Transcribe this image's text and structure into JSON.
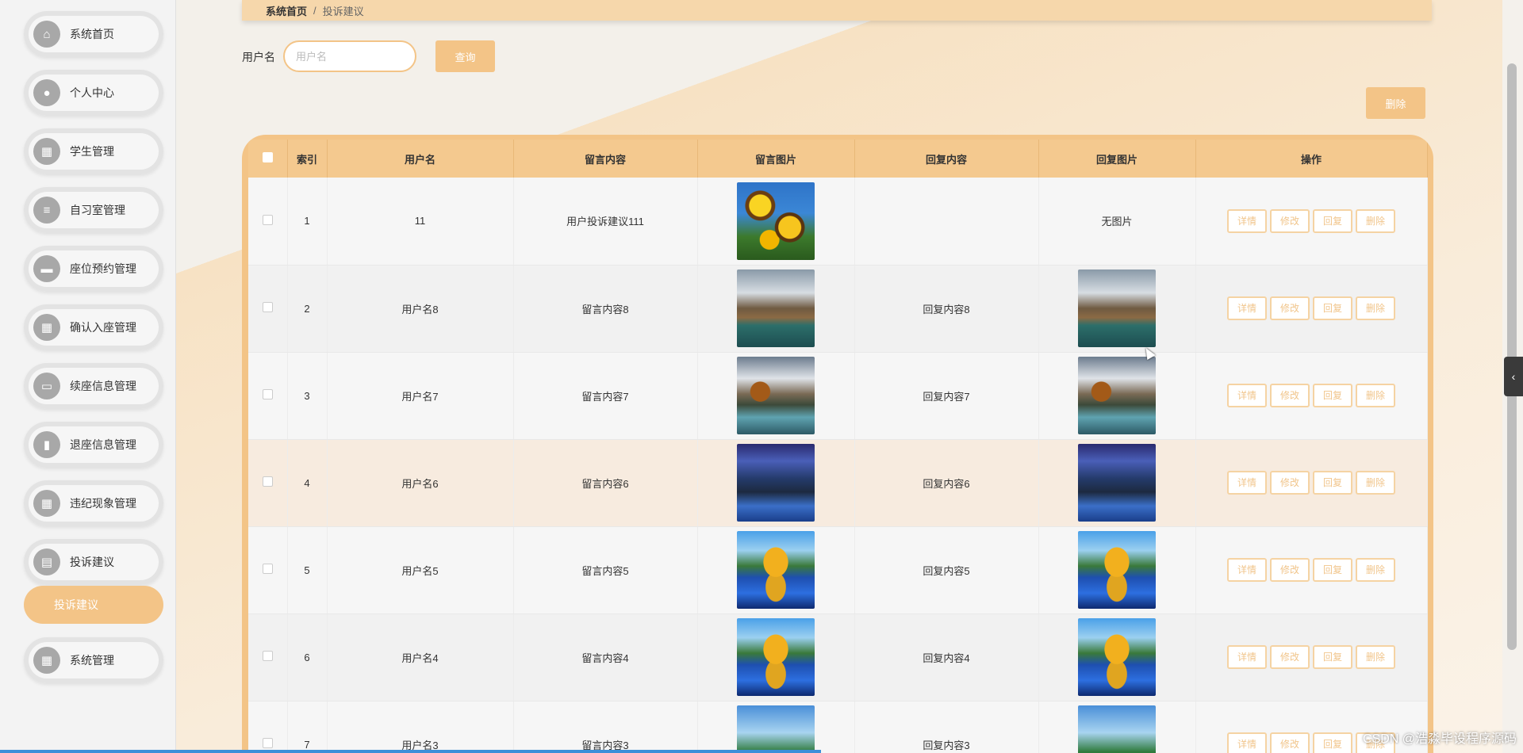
{
  "sidebar": {
    "items": [
      {
        "label": "系统首页",
        "icon": "home-icon",
        "glyph": "⌂"
      },
      {
        "label": "个人中心",
        "icon": "user-icon",
        "glyph": "●"
      },
      {
        "label": "学生管理",
        "icon": "grid-icon",
        "glyph": "▦"
      },
      {
        "label": "自习室管理",
        "icon": "list-icon",
        "glyph": "≡"
      },
      {
        "label": "座位预约管理",
        "icon": "ticket-icon",
        "glyph": "▬"
      },
      {
        "label": "确认入座管理",
        "icon": "grid-icon",
        "glyph": "▦"
      },
      {
        "label": "续座信息管理",
        "icon": "chat-icon",
        "glyph": "▭"
      },
      {
        "label": "退座信息管理",
        "icon": "bar-chart-icon",
        "glyph": "▮"
      },
      {
        "label": "违纪现象管理",
        "icon": "grid-icon",
        "glyph": "▦"
      },
      {
        "label": "投诉建议",
        "icon": "chart-icon",
        "glyph": "▤"
      },
      {
        "label": "系统管理",
        "icon": "grid-icon",
        "glyph": "▦"
      }
    ],
    "active_sub": "投诉建议"
  },
  "breadcrumb": {
    "home": "系统首页",
    "separator": "/",
    "current": "投诉建议"
  },
  "search": {
    "label": "用户名",
    "placeholder": "用户名",
    "button": "查询"
  },
  "toolbar": {
    "delete_label": "删除"
  },
  "table": {
    "headers": [
      "",
      "索引",
      "用户名",
      "留言内容",
      "留言图片",
      "回复内容",
      "回复图片",
      "操作"
    ],
    "actions": [
      "详情",
      "修改",
      "回复",
      "删除"
    ],
    "no_image_text": "无图片",
    "rows": [
      {
        "index": "1",
        "username": "11",
        "message": "用户投诉建议111",
        "msg_img": "sunflower",
        "reply": "",
        "reply_img": ""
      },
      {
        "index": "2",
        "username": "用户名8",
        "message": "留言内容8",
        "msg_img": "arch",
        "reply": "回复内容8",
        "reply_img": "arch"
      },
      {
        "index": "3",
        "username": "用户名7",
        "message": "留言内容7",
        "msg_img": "tree",
        "reply": "回复内容7",
        "reply_img": "tree"
      },
      {
        "index": "4",
        "username": "用户名6",
        "message": "留言内容6",
        "msg_img": "rocks",
        "reply": "回复内容6",
        "reply_img": "rocks"
      },
      {
        "index": "5",
        "username": "用户名5",
        "message": "留言内容5",
        "msg_img": "mountain",
        "reply": "回复内容5",
        "reply_img": "mountain"
      },
      {
        "index": "6",
        "username": "用户名4",
        "message": "留言内容4",
        "msg_img": "mountain",
        "reply": "回复内容4",
        "reply_img": "mountain"
      },
      {
        "index": "7",
        "username": "用户名3",
        "message": "留言内容3",
        "msg_img": "palm",
        "reply": "回复内容3",
        "reply_img": "palm"
      }
    ]
  },
  "watermark": "CSDN @浩淼毕设程序源码",
  "colors": {
    "accent": "#f3c487",
    "accent_text": "#f1c58b",
    "sidebar_icon": "#a8a8a8"
  }
}
